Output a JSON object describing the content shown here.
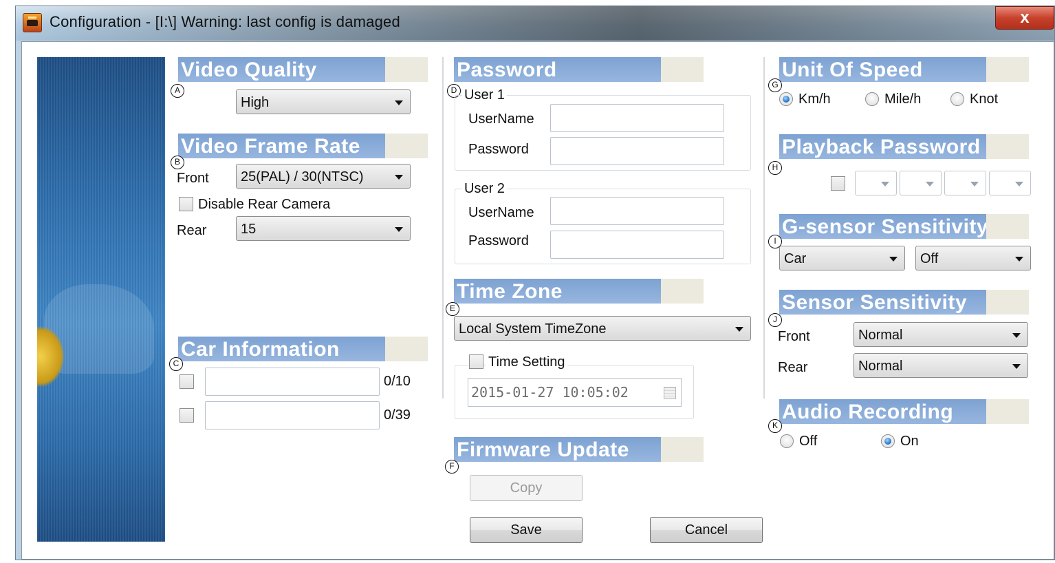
{
  "window": {
    "title": "Configuration - [I:\\] Warning: last config is damaged",
    "close_glyph": "x"
  },
  "badges": {
    "a": "A",
    "b": "B",
    "c": "C",
    "d": "D",
    "e": "E",
    "f": "F",
    "g": "G",
    "h": "H",
    "i": "I",
    "j": "J",
    "k": "K"
  },
  "video_quality": {
    "title": "Video Quality",
    "value": "High"
  },
  "video_frame_rate": {
    "title": "Video Frame Rate",
    "front_label": "Front",
    "front_value": "25(PAL) / 30(NTSC)",
    "disable_rear_label": "Disable Rear Camera",
    "disable_rear_checked": false,
    "rear_label": "Rear",
    "rear_value": "15"
  },
  "car_information": {
    "title": "Car Information",
    "fields": [
      {
        "value": "",
        "counter": "0/10",
        "checked": false
      },
      {
        "value": "",
        "counter": "0/39",
        "checked": false
      }
    ]
  },
  "password": {
    "title": "Password",
    "user1": {
      "group_label": "User 1",
      "username_label": "UserName",
      "password_label": "Password",
      "username": "",
      "password": ""
    },
    "user2": {
      "group_label": "User 2",
      "username_label": "UserName",
      "password_label": "Password",
      "username": "",
      "password": ""
    }
  },
  "time_zone": {
    "title": "Time Zone",
    "value": "Local System TimeZone",
    "time_setting_label": "Time Setting",
    "time_setting_checked": false,
    "datetime": "2015-01-27 10:05:02"
  },
  "firmware_update": {
    "title": "Firmware Update",
    "copy_label": "Copy"
  },
  "buttons": {
    "save": "Save",
    "cancel": "Cancel"
  },
  "unit_of_speed": {
    "title": "Unit Of Speed",
    "options": [
      {
        "label": "Km/h",
        "selected": true
      },
      {
        "label": "Mile/h",
        "selected": false
      },
      {
        "label": "Knot",
        "selected": false
      }
    ]
  },
  "playback_password": {
    "title": "Playback Password",
    "enabled": false,
    "digits": [
      "",
      "",
      "",
      ""
    ]
  },
  "g_sensor": {
    "title": "G-sensor Sensitivity",
    "vehicle": "Car",
    "level": "Off"
  },
  "sensor_sensitivity": {
    "title": "Sensor Sensitivity",
    "front_label": "Front",
    "front_value": "Normal",
    "rear_label": "Rear",
    "rear_value": "Normal"
  },
  "audio_recording": {
    "title": "Audio Recording",
    "options": [
      {
        "label": "Off",
        "selected": false
      },
      {
        "label": "On",
        "selected": true
      }
    ]
  },
  "colors": {
    "header_blue": "#8fb1dc",
    "header_tab": "#eceade",
    "title_bar": "#b4cde2",
    "close_red": "#c7422c",
    "banner_blue": "#2e6fae"
  }
}
